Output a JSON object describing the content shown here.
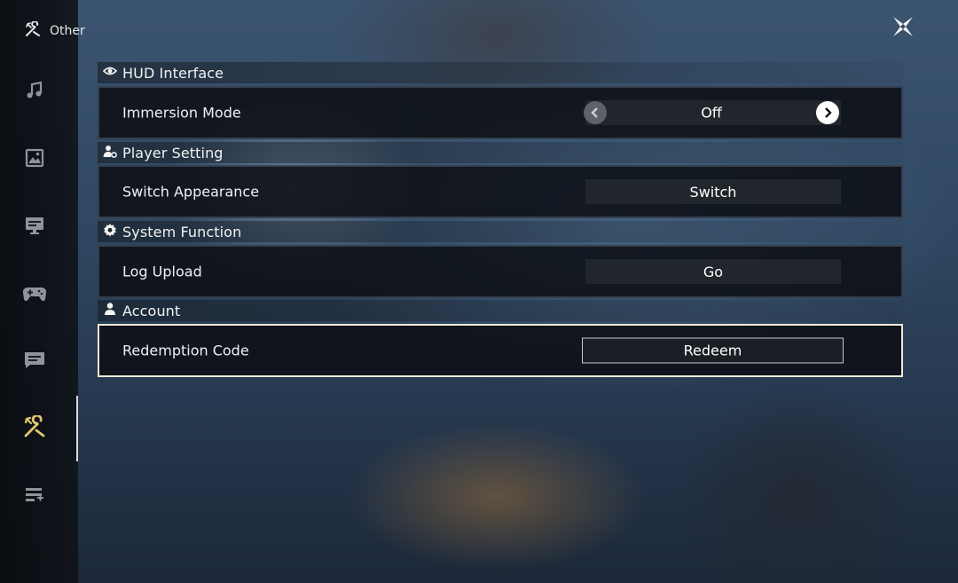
{
  "sidebar": {
    "header": {
      "label": "Other",
      "icon": "wrench-pencil-icon"
    },
    "items": [
      {
        "id": "audio",
        "icon": "music-note-icon",
        "active": false
      },
      {
        "id": "graphics",
        "icon": "image-icon",
        "active": false
      },
      {
        "id": "display",
        "icon": "monitor-icon",
        "active": false
      },
      {
        "id": "controls",
        "icon": "gamepad-icon",
        "active": false
      },
      {
        "id": "chat",
        "icon": "chat-icon",
        "active": false
      },
      {
        "id": "other",
        "icon": "wrench-pencil-icon",
        "active": true
      },
      {
        "id": "extra",
        "icon": "list-add-icon",
        "active": false
      }
    ],
    "active_color": "#e2c66e",
    "inactive_color": "#8f949b"
  },
  "close_icon": "close-x-icon",
  "sections": {
    "hud": {
      "title": "HUD Interface",
      "icon": "eye-icon",
      "rows": {
        "immersion": {
          "label": "Immersion Mode",
          "value": "Off"
        }
      }
    },
    "player": {
      "title": "Player Setting",
      "icon": "person-gear-icon",
      "rows": {
        "appearance": {
          "label": "Switch Appearance",
          "button": "Switch"
        }
      }
    },
    "system": {
      "title": "System Function",
      "icon": "gear-icon",
      "rows": {
        "log": {
          "label": "Log Upload",
          "button": "Go"
        }
      }
    },
    "account": {
      "title": "Account",
      "icon": "person-icon",
      "rows": {
        "redemption": {
          "label": "Redemption Code",
          "button": "Redeem",
          "selected": true
        }
      }
    }
  }
}
